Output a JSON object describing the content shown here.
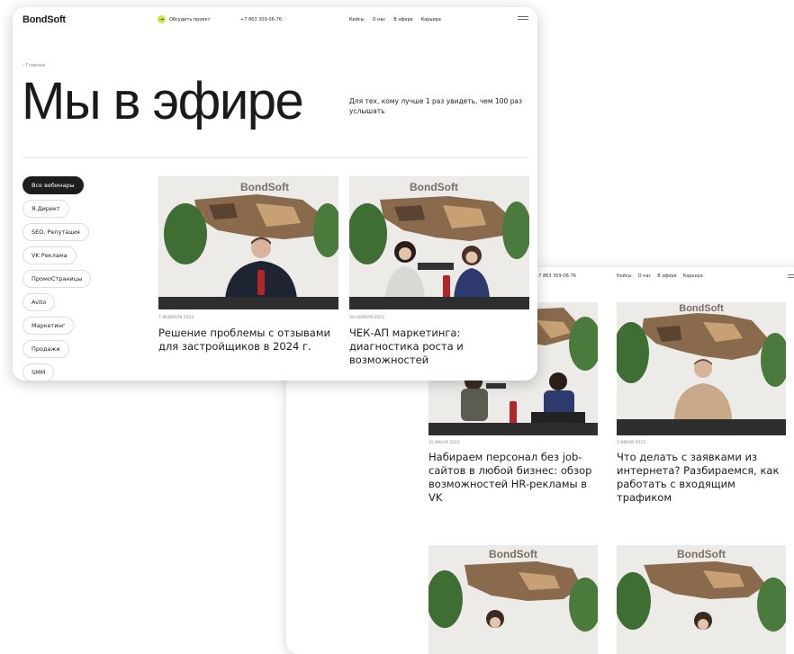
{
  "back": {
    "nav": {
      "phone": "+7 863 309-06-76",
      "links": [
        "Кейсы",
        "О нас",
        "В эфире",
        "Карьера"
      ],
      "menu_icon": "menu-icon"
    },
    "cards": [
      {
        "date": "15 ИЮНЯ 2023",
        "title": "Набираем персонал без job-сайтов в любой бизнес: обзор возможностей HR-рекламы в VK",
        "watermark": "BondSoft"
      },
      {
        "date": "2 ИЮНЯ 2023",
        "title": "Что делать с заявками из интернета? Разбираемся, как работать с входящим трафиком",
        "watermark": "BondSoft"
      },
      {
        "date": "",
        "title": "",
        "watermark": "BondSoft"
      },
      {
        "date": "",
        "title": "",
        "watermark": "BondSoft"
      }
    ]
  },
  "front": {
    "logo": "BondSoft",
    "discuss": {
      "label": "Обсудить проект",
      "icon": "arrow-icon",
      "color": "#c9e94a"
    },
    "phone": "+7 863 309-06-76",
    "nav": [
      "Кейсы",
      "О нас",
      "В эфире",
      "Карьера"
    ],
    "menu_icon": "menu-icon",
    "breadcrumb": "‹ Главная",
    "title": "Мы в эфире",
    "lead": "Для тех, кому лучше 1 раз увидеть, чем 100 раз услышать",
    "filters": [
      "Все вебинары",
      "Я.Директ",
      "SEO, Репутация",
      "VK Реклама",
      "ПромоСтраницы",
      "Avito",
      "Маркетинг",
      "Продажи",
      "SMM"
    ],
    "active_filter": "Все вебинары",
    "cards": [
      {
        "date": "7 ФЕВРАЛЯ 2024",
        "title": "Решение проблемы с отзывами для застройщиков в 2024 г.",
        "watermark": "BondSoft"
      },
      {
        "date": "30 НОЯБРЯ 2023",
        "title": "ЧЕК-АП маркетинга: диагностика роста и возможностей",
        "watermark": "BondSoft"
      }
    ]
  },
  "colors": {
    "accent": "#c9e94a",
    "dark": "#1d1d1d",
    "wall": "#ecebe8",
    "desk": "#2e2e2e"
  }
}
